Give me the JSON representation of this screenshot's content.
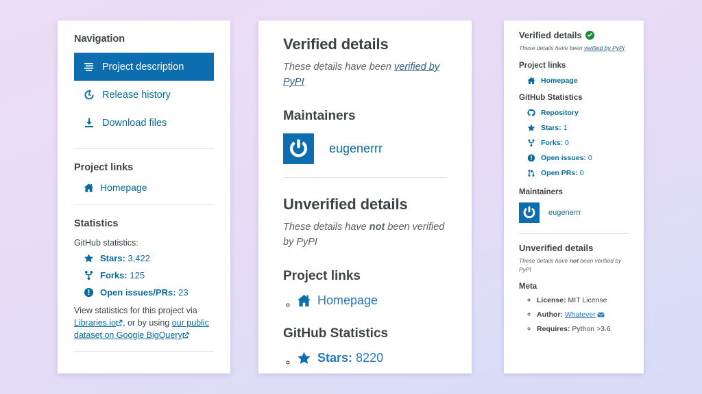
{
  "left_panel": {
    "nav_title": "Navigation",
    "nav_items": [
      {
        "label": "Project description",
        "icon": "list-lines-icon",
        "active": true
      },
      {
        "label": "Release history",
        "icon": "history-clock-icon",
        "active": false
      },
      {
        "label": "Download files",
        "icon": "download-icon",
        "active": false
      }
    ],
    "project_links_title": "Project links",
    "homepage_label": "Homepage",
    "statistics_title": "Statistics",
    "github_stats_note": "GitHub statistics:",
    "stats": [
      {
        "icon": "star-icon",
        "label": "Stars:",
        "value": "3,422"
      },
      {
        "icon": "fork-icon",
        "label": "Forks:",
        "value": "125"
      },
      {
        "icon": "exclamation-circle-icon",
        "label": "Open issues/PRs:",
        "value": "23"
      }
    ],
    "footer_text_1": "View statistics for this project via ",
    "footer_link_1": "Libraries.io",
    "footer_text_2": ", or by using ",
    "footer_link_2": "our public dataset on Google BigQuery"
  },
  "middle_panel": {
    "verified_title": "Verified details",
    "verified_sub_pre": "These details have been ",
    "verified_sub_link": "verified by PyPI",
    "maintainers_title": "Maintainers",
    "maintainer_name": "eugenerrr",
    "unverified_title": "Unverified details",
    "unverified_sub_pre": "These details have ",
    "unverified_sub_bold": "not",
    "unverified_sub_post": " been verified by PyPI",
    "project_links_title": "Project links",
    "homepage_label": "Homepage",
    "github_stats_title": "GitHub Statistics",
    "stars_label": "Stars:",
    "stars_value": "8220"
  },
  "right_panel": {
    "verified_title": "Verified details",
    "verified_badge": "verified-check-icon",
    "verified_sub_pre": "These details have been ",
    "verified_sub_link": "verified by PyPI",
    "project_links_title": "Project links",
    "homepage_label": "Homepage",
    "github_stats_title": "GitHub Statistics",
    "repository_label": "Repository",
    "stats": [
      {
        "icon": "star-icon",
        "label": "Stars:",
        "value": "1"
      },
      {
        "icon": "fork-icon",
        "label": "Forks:",
        "value": "0"
      },
      {
        "icon": "exclamation-circle-icon",
        "label": "Open issues:",
        "value": "0"
      },
      {
        "icon": "pull-request-icon",
        "label": "Open PRs:",
        "value": "0"
      }
    ],
    "maintainers_title": "Maintainers",
    "maintainer_name": "eugenerrr",
    "unverified_title": "Unverified details",
    "unverified_sub_pre": "These details have ",
    "unverified_sub_bold": "not",
    "unverified_sub_post": " been verified by PyPI",
    "meta_title": "Meta",
    "meta": [
      {
        "key": "License:",
        "value": " MIT License",
        "link": "",
        "mail": false
      },
      {
        "key": "Author:",
        "value": " ",
        "link": "Whatever",
        "mail": true
      },
      {
        "key": "Requires:",
        "value": " Python >3.6",
        "link": "",
        "mail": false
      }
    ]
  },
  "colors": {
    "accent_blue": "#0c6eaf",
    "link_blue": "#0a6c9c",
    "verified_green": "#1e8a3c",
    "text_dark": "#3e4345",
    "card_bg": "#ffffff"
  }
}
